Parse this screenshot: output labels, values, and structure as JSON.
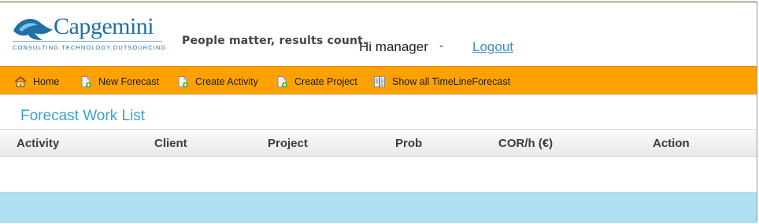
{
  "brand": {
    "name": "Capgemini",
    "tagline_small": "CONSULTING.TECHNOLOGY.OUTSOURCING",
    "slogan": "People matter, results count.",
    "colors": {
      "brand_blue": "#1f6fa8",
      "nav_orange": "#ffa200",
      "footer_blue": "#aee0f2",
      "title_blue": "#3aa0cf"
    }
  },
  "user": {
    "greeting": "Hi manager",
    "separator": "-",
    "logout_label": "Logout"
  },
  "nav": {
    "items": [
      {
        "label": "Home",
        "icon": "home-icon"
      },
      {
        "label": "New Forecast",
        "icon": "new-document-icon"
      },
      {
        "label": "Create Activity",
        "icon": "new-document-icon"
      },
      {
        "label": "Create Project",
        "icon": "new-document-icon"
      },
      {
        "label": "Show all TimeLineForecast",
        "icon": "list-document-icon"
      }
    ]
  },
  "page": {
    "title": "Forecast Work List"
  },
  "table": {
    "columns": [
      "Activity",
      "Client",
      "Project",
      "Prob",
      "COR/h (€)",
      "Action"
    ],
    "rows": []
  }
}
